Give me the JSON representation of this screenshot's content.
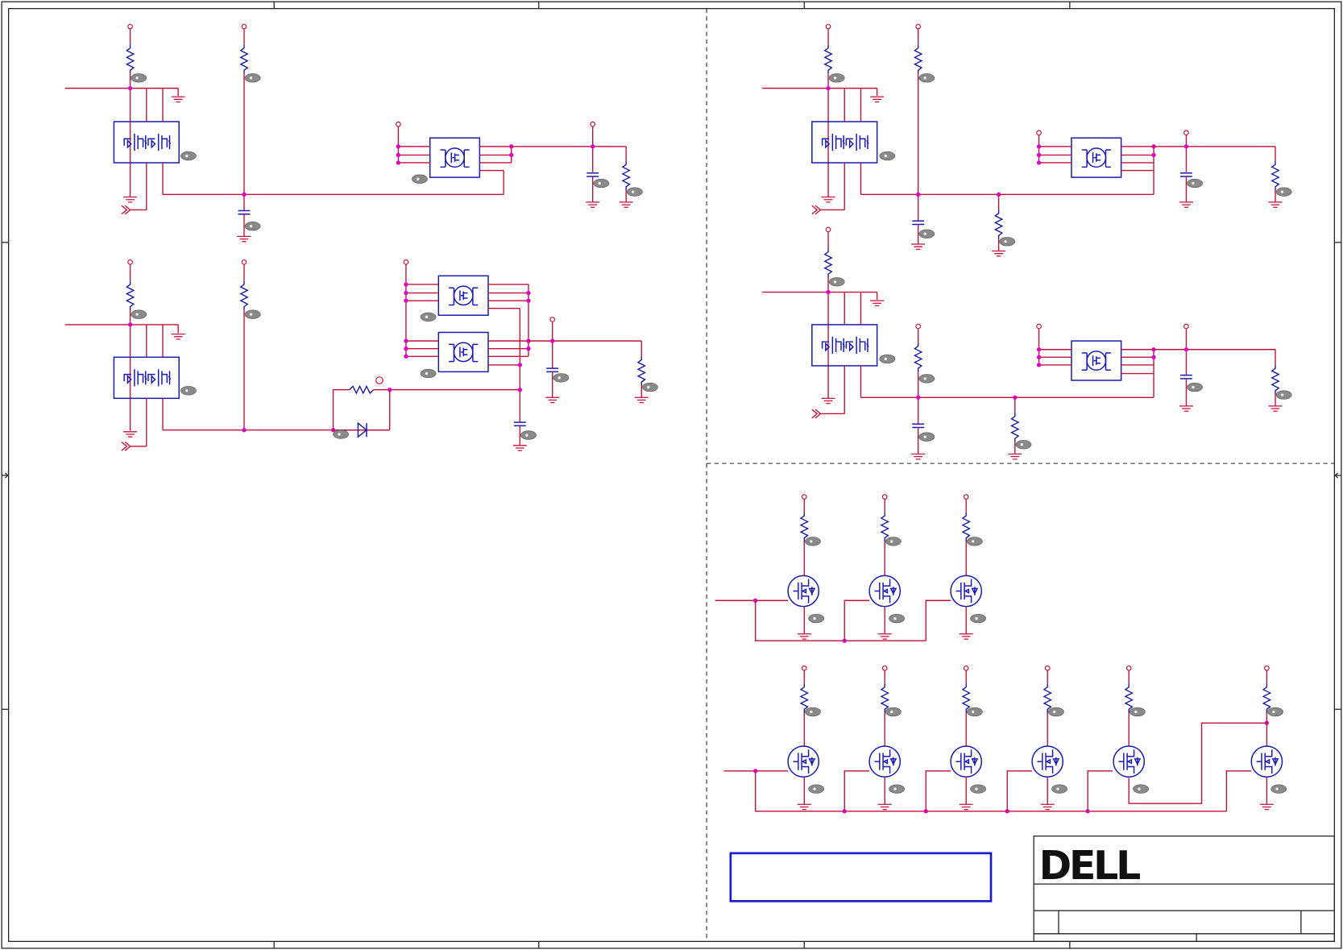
{
  "title_block": {
    "company_logo": "DELL",
    "logo_name": "dell-logo"
  },
  "colors": {
    "wire": "#c0123a",
    "component": "#1a1ab0",
    "junction": "#e000c0",
    "frame": "#222222",
    "notice_box": "#1a1ad0"
  },
  "icons": {
    "power_pin": "circle-pin",
    "ground": "ground-symbol",
    "resistor": "resistor-zigzag",
    "capacitor": "capacitor",
    "mosfet": "mosfet-circle",
    "dual_mosfet": "dual-mosfet-box",
    "diode": "diode",
    "off_page": "off-page-connector"
  }
}
